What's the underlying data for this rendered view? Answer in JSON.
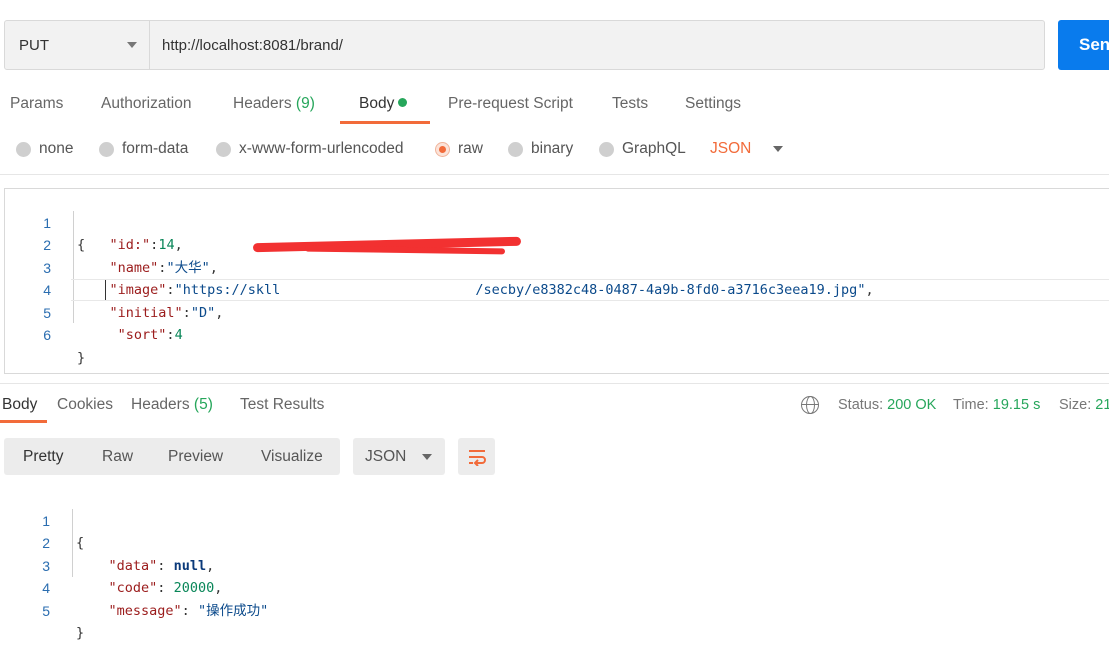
{
  "request": {
    "method": "PUT",
    "url": "http://localhost:8081/brand/",
    "send_label": "Send"
  },
  "request_tabs": [
    {
      "label": "Params"
    },
    {
      "label": "Authorization"
    },
    {
      "label": "Headers",
      "count": "(9)"
    },
    {
      "label": "Body"
    },
    {
      "label": "Pre-request Script"
    },
    {
      "label": "Tests"
    },
    {
      "label": "Settings"
    }
  ],
  "body_types": [
    "none",
    "form-data",
    "x-www-form-urlencoded",
    "raw",
    "binary",
    "GraphQL"
  ],
  "selected_body_type": "raw",
  "raw_format": "JSON",
  "request_body": {
    "line_numbers": [
      "1",
      "2",
      "3",
      "4",
      "5",
      "6"
    ],
    "brace_open": "{",
    "brace_close": "}",
    "id_key": "\"id:\"",
    "id_value": "14",
    "name_key": "\"name\"",
    "name_value": "\"大华\"",
    "image_key": "\"image\"",
    "image_value_start": "\"https://skll",
    "image_value_end": "/secby/e8382c48-0487-4a9b-8fd0-a3716c3eea19.jpg\"",
    "initial_key": "\"initial\"",
    "initial_value": "\"D\"",
    "sort_key": "\"sort\"",
    "sort_value": "4"
  },
  "response_tabs": [
    {
      "label": "Body"
    },
    {
      "label": "Cookies"
    },
    {
      "label": "Headers",
      "count": "(5)"
    },
    {
      "label": "Test Results"
    }
  ],
  "response_meta": {
    "status_label": "Status:",
    "status_value": "200 OK",
    "time_label": "Time:",
    "time_value": "19.15 s",
    "size_label": "Size:",
    "size_value": "21"
  },
  "view_modes": [
    "Pretty",
    "Raw",
    "Preview",
    "Visualize"
  ],
  "response_format": "JSON",
  "response_body": {
    "line_numbers": [
      "1",
      "2",
      "3",
      "4",
      "5"
    ],
    "brace_open": "{",
    "brace_close": "}",
    "data_key": "\"data\"",
    "data_value": "null",
    "code_key": "\"code\"",
    "code_value": "20000",
    "message_key": "\"message\"",
    "message_value": "\"操作成功\""
  },
  "colors": {
    "accent": "#f26b3a",
    "send": "#097bed",
    "success": "#26a65b",
    "redaction": "#f23131"
  },
  "icons": [
    "chevron-down-icon",
    "globe-icon",
    "wrap-lines-icon"
  ]
}
